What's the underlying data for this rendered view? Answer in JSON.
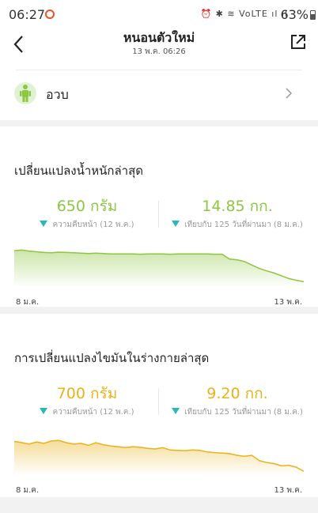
{
  "status_bar": {
    "time": "06:27",
    "indicators": "⏰ ✱ ≋ VoLTE ıl ıl",
    "battery": "63%"
  },
  "header": {
    "title": "หนอนตัวใหม่",
    "subtitle": "13 พ.ค. 06:26",
    "back_icon": "chevron-left-icon",
    "share_icon": "external-link-icon"
  },
  "profile": {
    "name": "อวบ",
    "avatar_icon": "person-icon",
    "avatar_color": "#8dc63f"
  },
  "weight_card": {
    "title": "เปลี่ยนแปลงน้ำหนักล่าสุด",
    "left_value": "650 กรัม",
    "left_caption": "ความคืบหน้า (12 พ.ค.)",
    "right_value": "14.85 กก.",
    "right_caption": "เทียบกับ 125 วันที่ผ่านมา (8 ม.ค.)",
    "x_start": "8 ม.ค.",
    "x_end": "13 พ.ค.",
    "accent": "#8dc63f"
  },
  "fat_card": {
    "title": "การเปลี่ยนแปลงไขมันในร่างกายล่าสุด",
    "left_value": "700 กรัม",
    "left_caption": "ความคืบหน้า (12 พ.ค.)",
    "right_value": "9.20 กก.",
    "right_caption": "เทียบกับ 125 วันที่ผ่านมา (8 ม.ค.)",
    "x_start": "8 ม.ค.",
    "x_end": "13 พ.ค.",
    "accent": "#e9b21a"
  },
  "chart_data": [
    {
      "type": "area",
      "series": [
        {
          "values": [
            0.95,
            0.97,
            0.94,
            0.92,
            0.9,
            0.89,
            0.91,
            0.9,
            0.89,
            0.88,
            0.87,
            0.88,
            0.87,
            0.86,
            0.86,
            0.86,
            0.86,
            0.85,
            0.86,
            0.86,
            0.86,
            0.85,
            0.86,
            0.86,
            0.86,
            0.86,
            0.86,
            0.85,
            0.85,
            0.71,
            0.69,
            0.64,
            0.54,
            0.44,
            0.37,
            0.31,
            0.23,
            0.15,
            0.1,
            0.06
          ]
        }
      ],
      "x_start_label": "8 ม.ค.",
      "x_end_label": "13 พ.ค.",
      "color": "#8dc63f"
    },
    {
      "type": "area",
      "series": [
        {
          "values": [
            0.92,
            0.88,
            0.84,
            0.9,
            0.86,
            0.93,
            0.95,
            0.88,
            0.84,
            0.86,
            0.8,
            0.88,
            0.82,
            0.78,
            0.76,
            0.73,
            0.76,
            0.74,
            0.71,
            0.69,
            0.73,
            0.66,
            0.65,
            0.64,
            0.66,
            0.65,
            0.6,
            0.58,
            0.57,
            0.55,
            0.5,
            0.47,
            0.5,
            0.34,
            0.28,
            0.25,
            0.18,
            0.2,
            0.14,
            0.02
          ]
        }
      ],
      "x_start_label": "8 ม.ค.",
      "x_end_label": "13 พ.ค.",
      "color": "#e9b21a"
    }
  ]
}
